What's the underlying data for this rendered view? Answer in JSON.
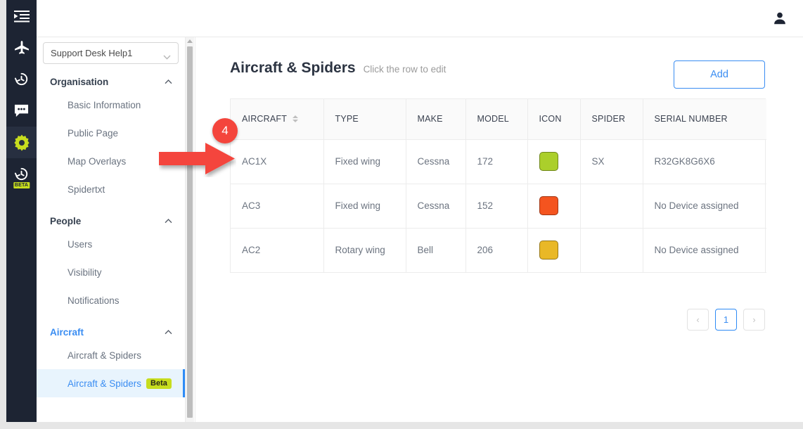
{
  "rail": {
    "items": [
      {
        "name": "menu-toggle-icon",
        "icon": "list-expand",
        "active": false,
        "badge": ""
      },
      {
        "name": "aircraft-icon",
        "icon": "airplane",
        "active": false,
        "badge": ""
      },
      {
        "name": "history-icon",
        "icon": "clock-back",
        "active": false,
        "badge": ""
      },
      {
        "name": "messages-icon",
        "icon": "chat-bubble",
        "active": false,
        "badge": ""
      },
      {
        "name": "settings-icon",
        "icon": "gear",
        "active": true,
        "badge": ""
      },
      {
        "name": "history-beta-icon",
        "icon": "clock-back",
        "active": false,
        "badge": "BETA"
      }
    ]
  },
  "topbar": {
    "account_icon": "user-avatar-icon"
  },
  "sidebar": {
    "org_select": {
      "value": "Support Desk Help1",
      "chevron": "chevron-down-icon"
    },
    "sections": [
      {
        "title": "Organisation",
        "active": false,
        "collapse_icon": "chevron-up-icon",
        "items": [
          {
            "label": "Basic Information",
            "badge": "",
            "selected": false
          },
          {
            "label": "Public Page",
            "badge": "",
            "selected": false
          },
          {
            "label": "Map Overlays",
            "badge": "",
            "selected": false
          },
          {
            "label": "Spidertxt",
            "badge": "",
            "selected": false
          }
        ]
      },
      {
        "title": "People",
        "active": false,
        "collapse_icon": "chevron-up-icon",
        "items": [
          {
            "label": "Users",
            "badge": "",
            "selected": false
          },
          {
            "label": "Visibility",
            "badge": "",
            "selected": false
          },
          {
            "label": "Notifications",
            "badge": "",
            "selected": false
          }
        ]
      },
      {
        "title": "Aircraft",
        "active": true,
        "collapse_icon": "chevron-up-icon",
        "items": [
          {
            "label": "Aircraft & Spiders",
            "badge": "",
            "selected": false
          },
          {
            "label": "Aircraft & Spiders",
            "badge": "Beta",
            "selected": true
          }
        ]
      }
    ]
  },
  "main": {
    "title": "Aircraft & Spiders",
    "subtitle": "Click the row to edit",
    "add_label": "Add",
    "table": {
      "columns": [
        {
          "label": "AIRCRAFT",
          "sortable": true
        },
        {
          "label": "TYPE",
          "sortable": false
        },
        {
          "label": "MAKE",
          "sortable": false
        },
        {
          "label": "MODEL",
          "sortable": false
        },
        {
          "label": "ICON",
          "sortable": false
        },
        {
          "label": "SPIDER",
          "sortable": false
        },
        {
          "label": "SERIAL NUMBER",
          "sortable": false
        }
      ],
      "rows": [
        {
          "aircraft": "AC1X",
          "type": "Fixed wing",
          "make": "Cessna",
          "model": "172",
          "icon_color": "#abcf2b",
          "spider": "SX",
          "serial": "R32GK8G6X6"
        },
        {
          "aircraft": "AC3",
          "type": "Fixed wing",
          "make": "Cessna",
          "model": "152",
          "icon_color": "#f4541f",
          "spider": "",
          "serial": "No Device assigned"
        },
        {
          "aircraft": "AC2",
          "type": "Rotary wing",
          "make": "Bell",
          "model": "206",
          "icon_color": "#e9b827",
          "spider": "",
          "serial": "No Device assigned"
        }
      ]
    },
    "pagination": {
      "prev": "‹",
      "current": "1",
      "next": "›"
    }
  },
  "annotation": {
    "step_number": "4",
    "arrow_color": "#f4453c"
  }
}
